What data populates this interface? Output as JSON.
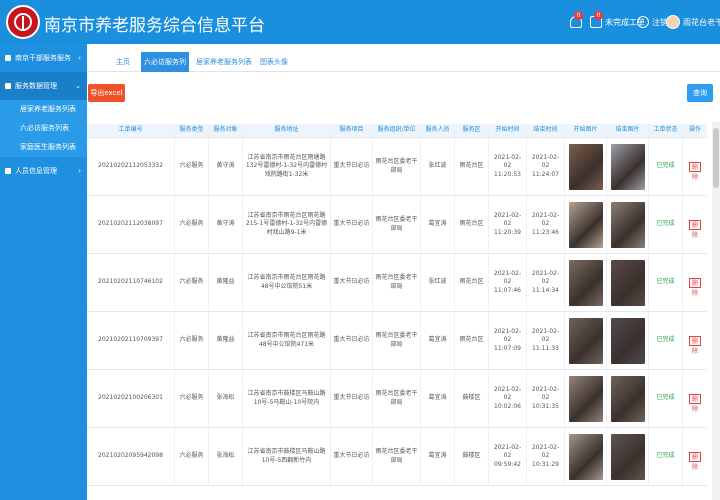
{
  "header": {
    "title": "南京市养老服务综合信息平台",
    "notif_badge": "0",
    "orders_badge": "0",
    "orders_label": "未完成工单",
    "logout_label": "注销",
    "user_label": "雨花台老干局"
  },
  "sidebar": {
    "items": [
      {
        "label": "南京干部服务服务",
        "chevron": "›"
      },
      {
        "label": "服务数据管理",
        "chevron": "⌄",
        "children": [
          "居家养老服务列表",
          "六必访服务列表",
          "家庭医生服务列表"
        ]
      },
      {
        "label": "人员信息管理",
        "chevron": "›"
      }
    ]
  },
  "tabs": [
    "主页",
    "六必访服务列表",
    "居家养老服务列表",
    "图表头像"
  ],
  "active_tab": "六必访服务列表",
  "toolbar": {
    "export_label": "导出excel",
    "query_label": "查询"
  },
  "table": {
    "headers": [
      "工单编号",
      "服务类型",
      "服务对象",
      "服务地址",
      "服务项目",
      "服务组织/单位",
      "服务人员",
      "服务区",
      "开始时间",
      "结束时间",
      "开始图片",
      "结束图片",
      "工单状态",
      "操作"
    ],
    "rows": [
      {
        "id": "20210202112053332",
        "type": "六必服务",
        "client": "黄守涛",
        "address": "江苏省南京市雨花台区雨塘路132号雷德村-1-32号内雷德村戏院路街1-32米",
        "item": "重大节日必访",
        "org": "雨花台区委老干部局",
        "staff": "张红波",
        "district": "雨花台区",
        "start": "2021-02-02 11:20:53",
        "end": "2021-02-02 11:24:07",
        "status": "已完成",
        "action": "删除",
        "photo_colors": [
          "#7d5e4a",
          "#9aa0a8"
        ]
      },
      {
        "id": "20210202112038097",
        "type": "六必服务",
        "client": "黄守涛",
        "address": "江苏省南京市雨花台区雨花路215-1号雷德村-1-32号内雷德村戏山路9-1米",
        "item": "重大节日必访",
        "org": "雨花台区委老干部局",
        "staff": "葛宜涛",
        "district": "雨花台区",
        "start": "2021-02-02 11:20:39",
        "end": "2021-02-02 11:23:46",
        "status": "已完成",
        "action": "删除",
        "photo_colors": [
          "#b5a392",
          "#8a7f78"
        ]
      },
      {
        "id": "20210202110746102",
        "type": "六必服务",
        "client": "黄隆益",
        "address": "江苏省南京市雨花台区雨花路48号中公馆院51米",
        "item": "重大节日必访",
        "org": "雨花台区委老干部局",
        "staff": "张红波",
        "district": "雨花台区",
        "start": "2021-02-02 11:07:46",
        "end": "2021-02-02 11:14:34",
        "status": "已完成",
        "action": "删除",
        "photo_colors": [
          "#7a6a62",
          "#5b4a48"
        ]
      },
      {
        "id": "20210202110709397",
        "type": "六必服务",
        "client": "黄隆益",
        "address": "江苏省南京市雨花台区雨花路48号中公馆院471米",
        "item": "重大节日必访",
        "org": "雨花台区委老干部局",
        "staff": "葛宜涛",
        "district": "雨花台区",
        "start": "2021-02-02 11:07:09",
        "end": "2021-02-02 11:11:33",
        "status": "已完成",
        "action": "删除",
        "photo_colors": [
          "#6f635f",
          "#4f4a52"
        ]
      },
      {
        "id": "20210202100206301",
        "type": "六必服务",
        "client": "张海松",
        "address": "江苏省南京市鼓楼区马鞍山路10号-5马鞍山-10号院内",
        "item": "重大节日必访",
        "org": "雨花台区委老干部局",
        "staff": "葛宜涛",
        "district": "鼓楼区",
        "start": "2021-02-02 10:02:06",
        "end": "2021-02-02 10:31:35",
        "status": "已完成",
        "action": "删除",
        "photo_colors": [
          "#93847a",
          "#6f6258"
        ]
      },
      {
        "id": "20210202095942098",
        "type": "六必服务",
        "client": "张海松",
        "address": "江苏省南京市鼓楼区马鞍山路10号-5西翻新竹内",
        "item": "重大节日必访",
        "org": "雨花台区委老干部局",
        "staff": "葛宜涛",
        "district": "鼓楼区",
        "start": "2021-02-02 09:59:42",
        "end": "2021-02-02 10:31:29",
        "status": "已完成",
        "action": "删除",
        "photo_colors": [
          "#a2968c",
          "#5e554f"
        ]
      }
    ]
  },
  "colors": {
    "header_bg": "#1a8fdd",
    "sidebar_bg": "#1f8fe0",
    "accent": "#2f8fe0",
    "export": "#f0522b",
    "status_done": "#21a447",
    "delete": "#e04141"
  }
}
